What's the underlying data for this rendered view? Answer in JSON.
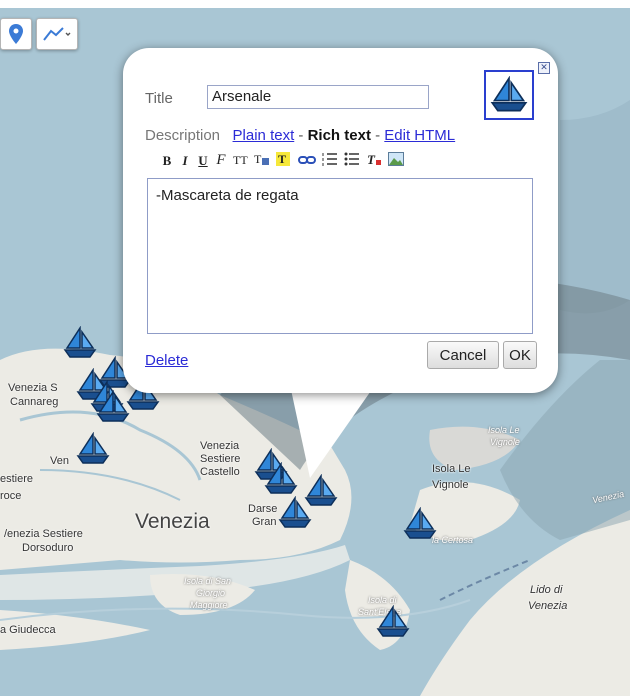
{
  "toolbar": {
    "place_icon": "map-pin-icon",
    "line_icon": "draw-line-icon"
  },
  "dialog": {
    "title_label": "Title",
    "title_value": "Arsenale",
    "description_label": "Description",
    "plain_text_link": "Plain text",
    "sep1": "-",
    "rich_text_label": "Rich text",
    "sep2": "-",
    "edit_html_link": "Edit HTML",
    "format_bold": "B",
    "format_italic": "I",
    "format_underline": "U",
    "format_font": "F",
    "format_size": "TT",
    "description_text": "-Mascareta de regata",
    "delete_link": "Delete",
    "cancel_button": "Cancel",
    "ok_button": "OK",
    "close_icon": "close-icon",
    "selected_icon": "sailboat-icon"
  },
  "map_labels": {
    "venezia": "Venezia",
    "venezia_s": "Venezia S",
    "cannareg": "Cannareg",
    "ven": "Ven",
    "venezia_sestiere_castello_1": "Venezia",
    "venezia_sestiere_castello_2": "Sestiere",
    "venezia_sestiere_castello_3": "Castello",
    "darsena_1": "Darse",
    "darsena_2": "Gran",
    "estiere": "estiere",
    "roce": "roce",
    "dorsoduro_1": "/enezia Sestiere",
    "dorsoduro_2": "Dorsoduro",
    "isola_vignole_1": "Isola Le",
    "isola_vignole_2": "Vignole",
    "isola_vignole_3": "Isola Le",
    "isola_vignole_4": "Vignole",
    "la_certosa": "la Certosa",
    "san_giorgio_1": "Isola di San",
    "san_giorgio_2": "Giorgio",
    "san_giorgio_3": "Maggiore",
    "isola_di": "Isola di",
    "sant_elena": "Sant'Elena",
    "lido_1": "Lido di",
    "lido_2": "Venezia",
    "giudecca": "a Giudecca",
    "venezia_road": "Venezia"
  },
  "colors": {
    "water": "#a9c6d4",
    "land": "#ecebe5",
    "link": "#2b2bd6",
    "icon_border": "#2a3fcf"
  }
}
